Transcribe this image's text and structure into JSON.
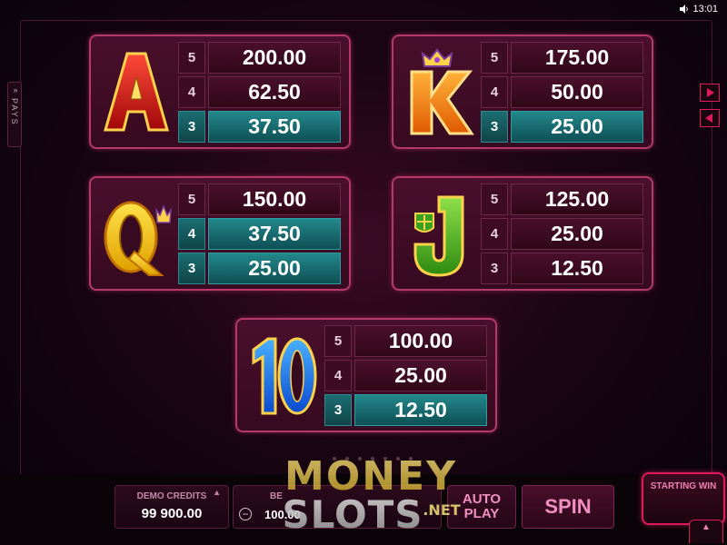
{
  "status_bar": {
    "time": "13:01",
    "icon": "speaker-icon"
  },
  "side_tab": {
    "label": "PAYS",
    "icon": "double-chevron-right-icon"
  },
  "nav": {
    "next_icon": "arrow-right-icon",
    "prev_icon": "arrow-left-icon"
  },
  "paytable": [
    {
      "symbol": "A",
      "icon": "ace-symbol-icon",
      "rows": [
        {
          "count": "5",
          "pay": "200.00"
        },
        {
          "count": "4",
          "pay": "62.50"
        },
        {
          "count": "3",
          "pay": "37.50"
        }
      ]
    },
    {
      "symbol": "K",
      "icon": "king-symbol-icon",
      "rows": [
        {
          "count": "5",
          "pay": "175.00"
        },
        {
          "count": "4",
          "pay": "50.00"
        },
        {
          "count": "3",
          "pay": "25.00"
        }
      ]
    },
    {
      "symbol": "Q",
      "icon": "queen-symbol-icon",
      "rows": [
        {
          "count": "5",
          "pay": "150.00"
        },
        {
          "count": "4",
          "pay": "37.50"
        },
        {
          "count": "3",
          "pay": "25.00"
        }
      ]
    },
    {
      "symbol": "J",
      "icon": "jack-symbol-icon",
      "rows": [
        {
          "count": "5",
          "pay": "125.00"
        },
        {
          "count": "4",
          "pay": "25.00"
        },
        {
          "count": "3",
          "pay": "12.50"
        }
      ]
    },
    {
      "symbol": "10",
      "icon": "ten-symbol-icon",
      "rows": [
        {
          "count": "5",
          "pay": "100.00"
        },
        {
          "count": "4",
          "pay": "25.00"
        },
        {
          "count": "3",
          "pay": "12.50"
        }
      ]
    }
  ],
  "bottom_bar": {
    "credits_label": "DEMO CREDITS",
    "credits_value": "99 900.00",
    "bet_label": "BE",
    "bet_value": "100.00",
    "minus_label": "−",
    "auto_play_label": "AUTO PLAY",
    "spin_label": "SPIN",
    "starting_win_label": "STARTING WIN"
  },
  "watermark": {
    "line1": "MONEY",
    "line2": "SLOTS",
    "suffix": ".NET"
  },
  "colors": {
    "accent": "#e01a5a",
    "teal": "#23888c",
    "panel": "#4a0f2c"
  }
}
